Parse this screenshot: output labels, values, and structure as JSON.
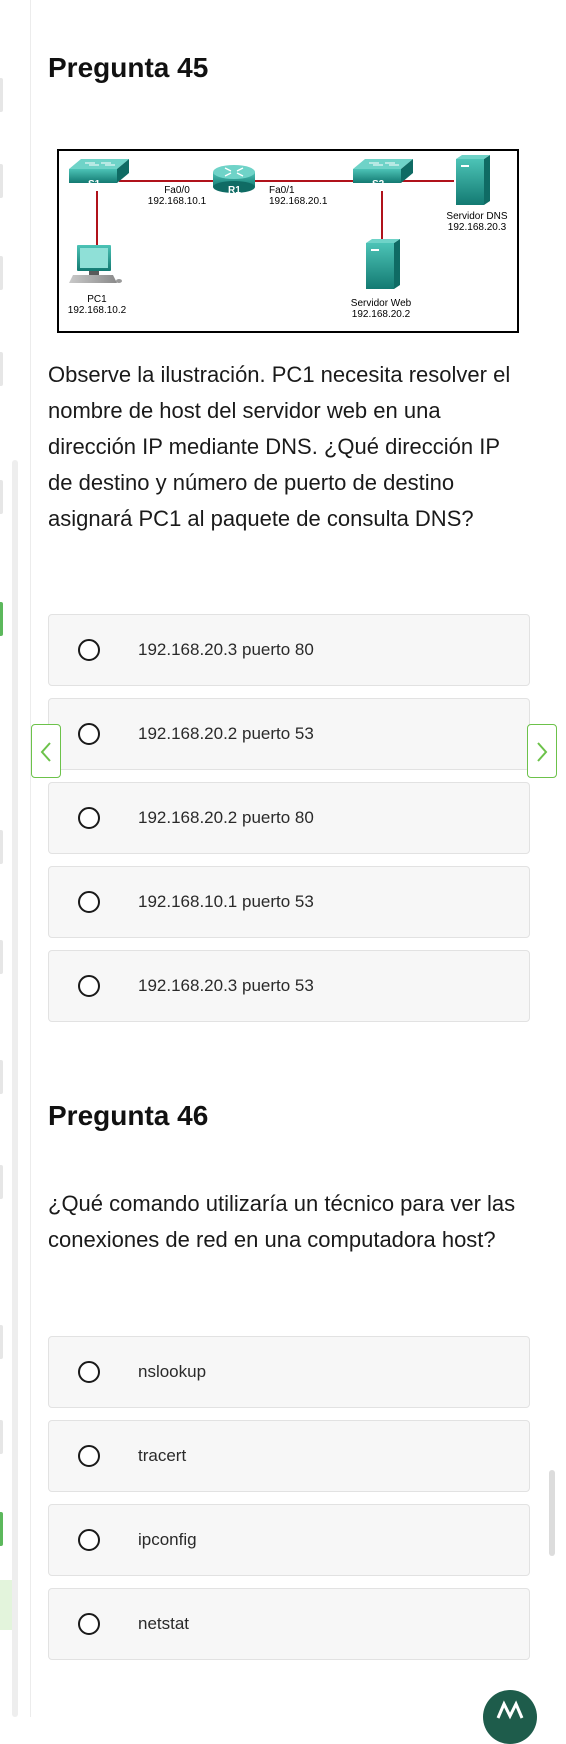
{
  "questions": [
    {
      "heading": "Pregunta 45",
      "text": "Observe la ilustración. PC1 necesita resolver el nombre de host del servidor web en una dirección IP mediante DNS. ¿Qué dirección IP de destino y número de puerto de destino asignará PC1 al paquete de consulta DNS?",
      "options": [
        "192.168.20.3 puerto 80",
        "192.168.20.2 puerto 53",
        "192.168.20.2 puerto 80",
        "192.168.10.1 puerto 53",
        "192.168.20.3 puerto 53"
      ]
    },
    {
      "heading": "Pregunta 46",
      "text": "¿Qué comando utilizaría un técnico para ver las conexiones de red en una computadora host?",
      "options": [
        "nslookup",
        "tracert",
        "ipconfig",
        "netstat"
      ]
    }
  ],
  "diagram": {
    "s1": "S1",
    "r1": "R1",
    "s2": "S2",
    "fa00": "Fa0/0",
    "fa00_ip": "192.168.10.1",
    "fa01": "Fa0/1",
    "fa01_ip": "192.168.20.1",
    "dns_name": "Servidor DNS",
    "dns_ip": "192.168.20.3",
    "pc1_name": "PC1",
    "pc1_ip": "192.168.10.2",
    "web_name": "Servidor Web",
    "web_ip": "192.168.20.2"
  },
  "icons": {
    "prev": "chevron-left-icon",
    "next": "chevron-right-icon",
    "radio": "radio-unchecked-icon"
  },
  "colors": {
    "accent_green": "#6cc24a",
    "device_teal": "#1f9e95",
    "link_red": "#b0121b",
    "option_bg": "#f7f7f7"
  }
}
